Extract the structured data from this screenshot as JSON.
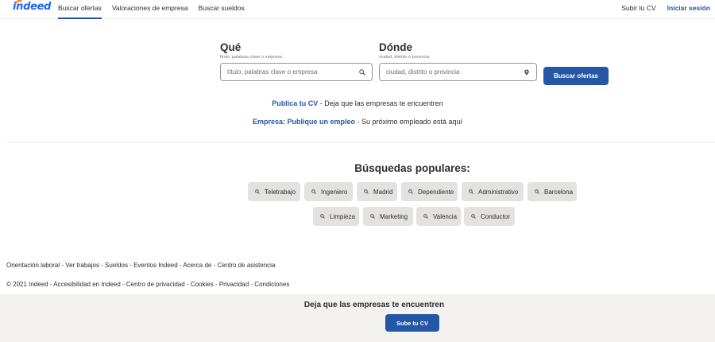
{
  "header": {
    "logo": "indeed",
    "nav": [
      "Buscar ofertas",
      "Valoraciones de empresa",
      "Buscar sueldos"
    ],
    "upload_cv": "Subir tu CV",
    "signin": "Iniciar sesión"
  },
  "search": {
    "what_title": "Qué",
    "what_sub": "título, palabras clave o empresa",
    "what_placeholder": "título, palabras clave o empresa",
    "where_title": "Dónde",
    "where_sub": "ciudad, distrito o provincia",
    "where_placeholder": "ciudad, distrito o provincia",
    "button": "Buscar ofertas"
  },
  "promos": {
    "cv_link": "Publica tu CV",
    "cv_text": " - Deja que las empresas te encuentren",
    "employer_link": "Empresa: Publique un empleo",
    "employer_text": " - Su próximo empleado está aquí"
  },
  "popular": {
    "title": "Búsquedas populares:",
    "row1": [
      "Teletrabajo",
      "Ingeniero",
      "Madrid",
      "Dependiente",
      "Administrativo",
      "Barcelona"
    ],
    "row2": [
      "Limpieza",
      "Marketing",
      "Valencia",
      "Conductor"
    ]
  },
  "footer": {
    "line1": "Orientación laboral - Ver trabajos - Sueldos - Eventos Indeed - Acerca de - Centro de asistencia",
    "line2": "© 2021 Indeed - Accesibilidad en Indeed - Centro de privacidad - Cookies - Privacidad - Condiciones"
  },
  "cta": {
    "title": "Deja que las empresas te encuentren",
    "button": "Sube tu CV"
  },
  "colors": {
    "brand_blue": "#2557a7",
    "logo_blue": "#2164f3",
    "logo_orange": "#ff6b00",
    "chip_bg": "#e4e2e0",
    "cta_bg": "#f3f2f1"
  },
  "icons": {
    "search": "search-icon",
    "location": "location-pin-icon"
  }
}
